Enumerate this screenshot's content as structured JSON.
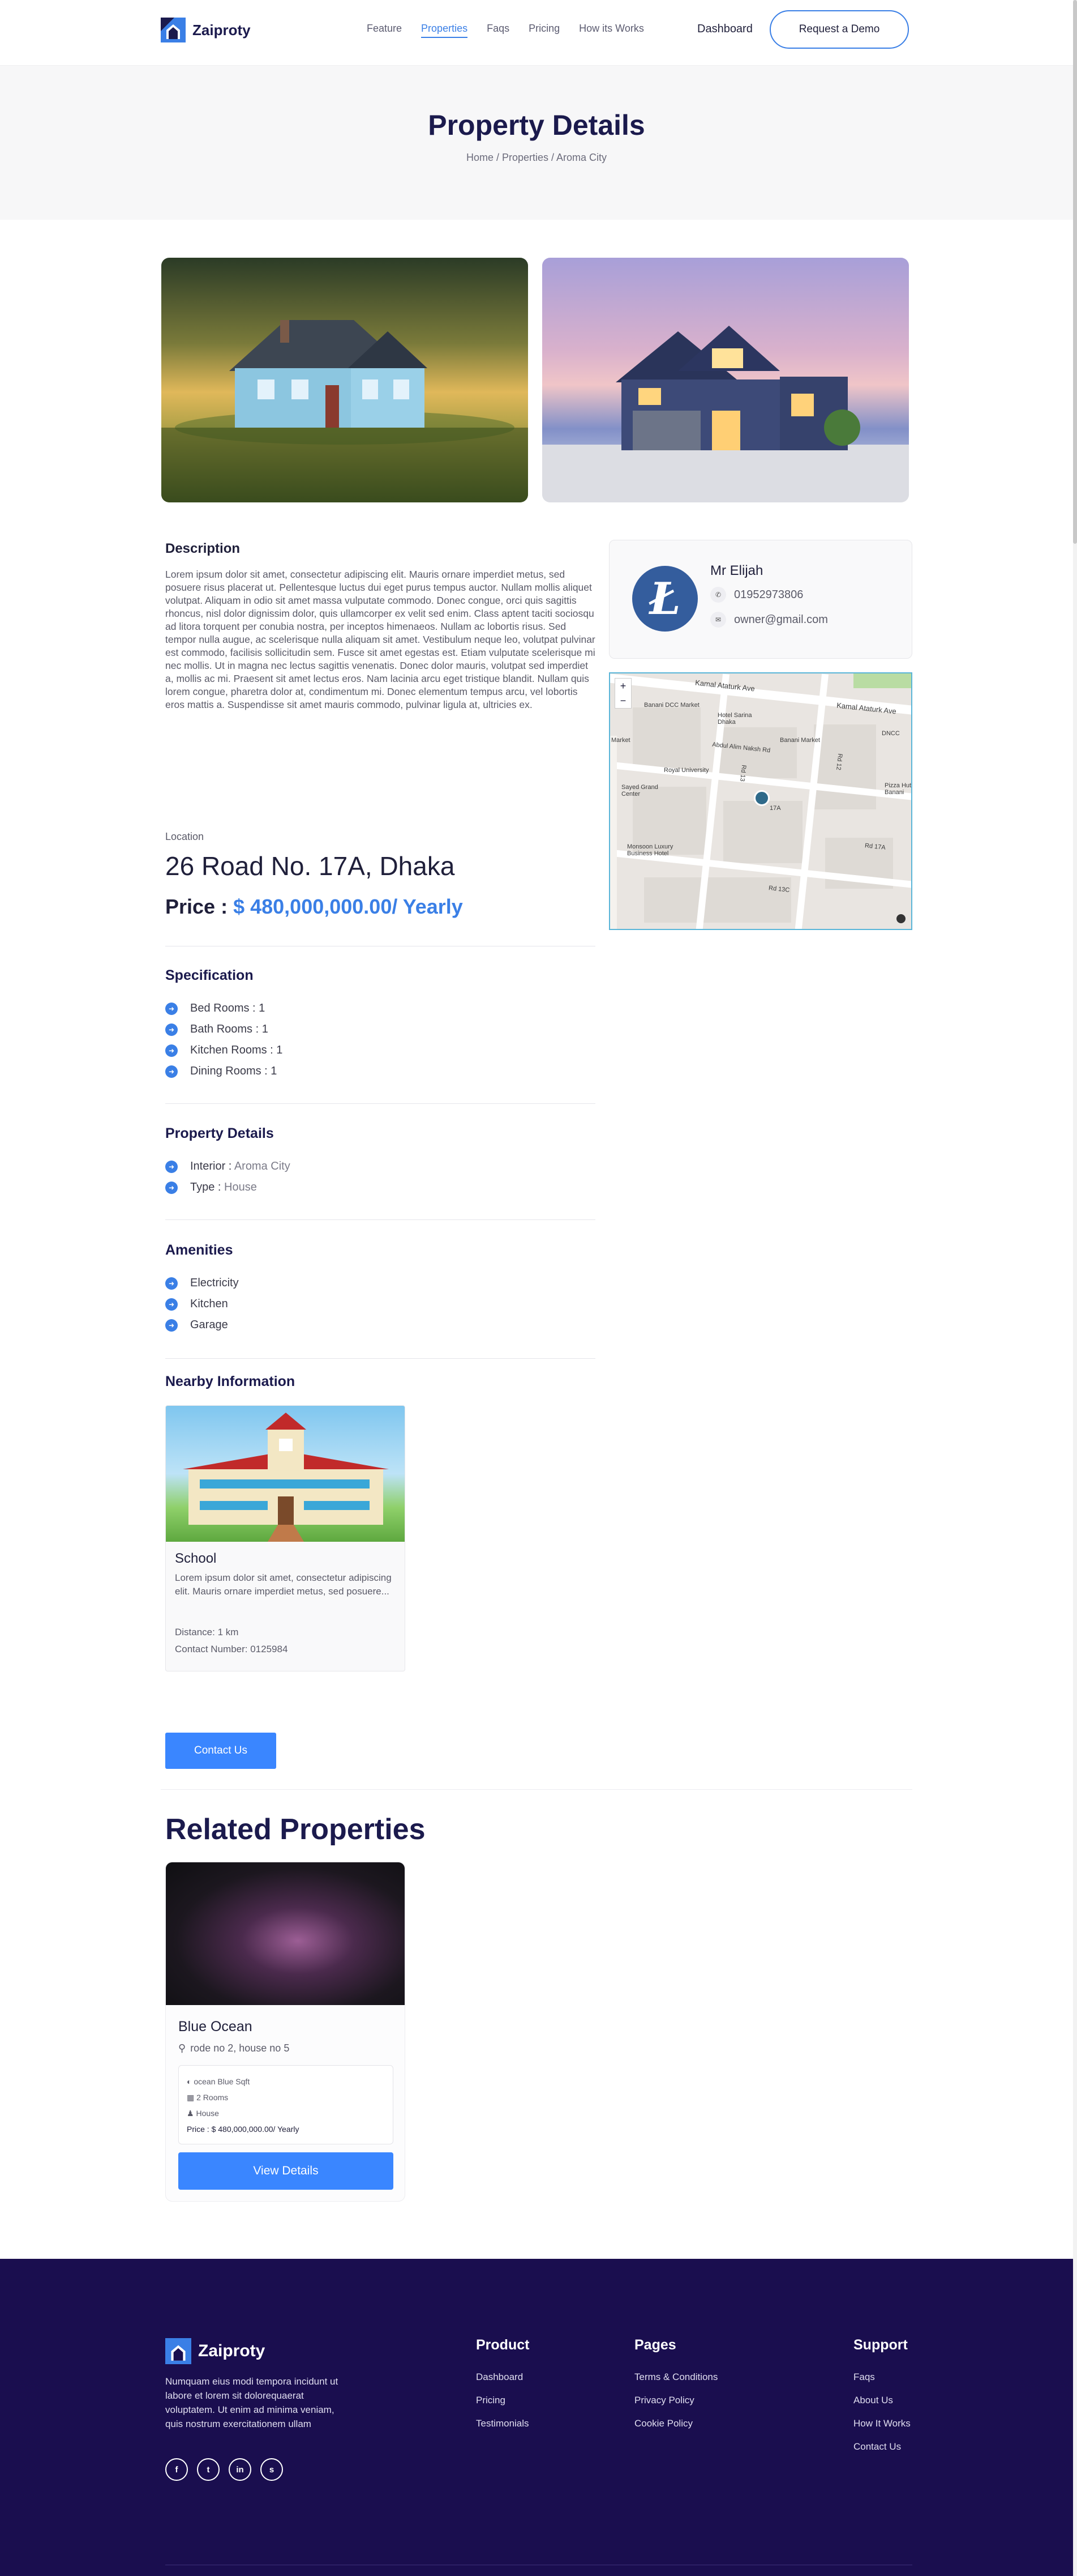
{
  "header": {
    "brand": "Zaiproty",
    "nav": [
      "Feature",
      "Properties",
      "Faqs",
      "Pricing",
      "How its Works"
    ],
    "active_nav": "Properties",
    "dashboard": "Dashboard",
    "demo": "Request a Demo"
  },
  "banner": {
    "title": "Property Details",
    "breadcrumb": "Home / Properties / Aroma City"
  },
  "description": {
    "title": "Description",
    "body": "Lorem ipsum dolor sit amet, consectetur adipiscing elit. Mauris ornare imperdiet metus, sed posuere risus placerat ut. Pellentesque luctus dui eget purus tempus auctor. Nullam mollis aliquet volutpat. Aliquam in odio sit amet massa vulputate commodo. Donec congue, orci quis sagittis rhoncus, nisl dolor dignissim dolor, quis ullamcorper ex velit sed enim. Class aptent taciti sociosqu ad litora torquent per conubia nostra, per inceptos himenaeos. Nullam ac lobortis risus. Sed tempor nulla augue, ac scelerisque nulla aliquam sit amet. Vestibulum neque leo, volutpat pulvinar est commodo, facilisis sollicitudin sem. Fusce sit amet egestas est. Etiam vulputate scelerisque mi nec mollis. Ut in magna nec lectus sagittis venenatis. Donec dolor mauris, volutpat sed imperdiet a, mollis ac mi. Praesent sit amet lectus eros. Nam lacinia arcu eget tristique blandit. Nullam quis lorem congue, pharetra dolor at, condimentum mi. Donec elementum tempus arcu, vel lobortis eros mattis a. Suspendisse sit amet mauris commodo, pulvinar ligula at, ultricies ex."
  },
  "owner": {
    "name": "Mr Elijah",
    "phone": "01952973806",
    "email": "owner@gmail.com"
  },
  "map": {
    "labels": [
      "Kamal Ataturk Ave",
      "Kamal Ataturk Ave",
      "Banani DCC Market",
      "Hotel Sarina Dhaka",
      "Banani Market",
      "Abdul Alim Naksh Rd",
      "Royal University",
      "Sayed Grand Center",
      "Rd 13",
      "Rd 12",
      "Rd 17A",
      "Rd 13C",
      "Monsoon Luxury Business Hotel",
      "Market",
      "DNCC",
      "Pizza Hut Banani",
      "17A"
    ],
    "zoom_in": "+",
    "zoom_out": "−"
  },
  "location": {
    "label": "Location",
    "address": "26 Road No. 17A, Dhaka",
    "price_label": "Price :",
    "price_value": "$ 480,000,000.00/ Yearly"
  },
  "specification": {
    "title": "Specification",
    "items": [
      "Bed Rooms : 1",
      "Bath Rooms : 1",
      "Kitchen Rooms : 1",
      "Dining Rooms : 1"
    ]
  },
  "property_details": {
    "title": "Property Details",
    "items": [
      {
        "label": "Interior :",
        "value": "Aroma City"
      },
      {
        "label": "Type :",
        "value": "House"
      }
    ]
  },
  "amenities": {
    "title": "Amenities",
    "items": [
      "Electricity",
      "Kitchen",
      "Garage"
    ]
  },
  "nearby": {
    "title": "Nearby Information",
    "name": "School",
    "text": "Lorem ipsum dolor sit amet, consectetur adipiscing elit. Mauris ornare imperdiet metus, sed posuere...",
    "distance": "Distance: 1 km",
    "contact": "Contact Number: 0125984"
  },
  "contact_button": "Contact Us",
  "related": {
    "title": "Related Properties",
    "card": {
      "name": "Blue Ocean",
      "address": "rode no 2, house no 5",
      "size": "ocean Blue Sqft",
      "rooms": "2 Rooms",
      "type": "House",
      "price": "Price : $ 480,000,000.00/ Yearly",
      "button": "View Details"
    }
  },
  "footer": {
    "brand": "Zaiproty",
    "text": "Numquam eius modi tempora incidunt ut labore et lorem sit dolorequaerat voluptatem. Ut enim ad minima veniam, quis nostrum exercitationem ullam",
    "social": [
      "f",
      "t",
      "in",
      "s"
    ],
    "columns": [
      {
        "title": "Product",
        "links": [
          "Dashboard",
          "Pricing",
          "Testimonials"
        ]
      },
      {
        "title": "Pages",
        "links": [
          "Terms & Conditions",
          "Privacy Policy",
          "Cookie Policy"
        ]
      },
      {
        "title": "Support",
        "links": [
          "Faqs",
          "About Us",
          "How It Works",
          "Contact Us"
        ]
      }
    ]
  },
  "colors": {
    "accent": "#3a7fe6",
    "button": "#3a86ff",
    "heading": "#1b1a4d",
    "footer_bg": "#1a0e4f"
  }
}
